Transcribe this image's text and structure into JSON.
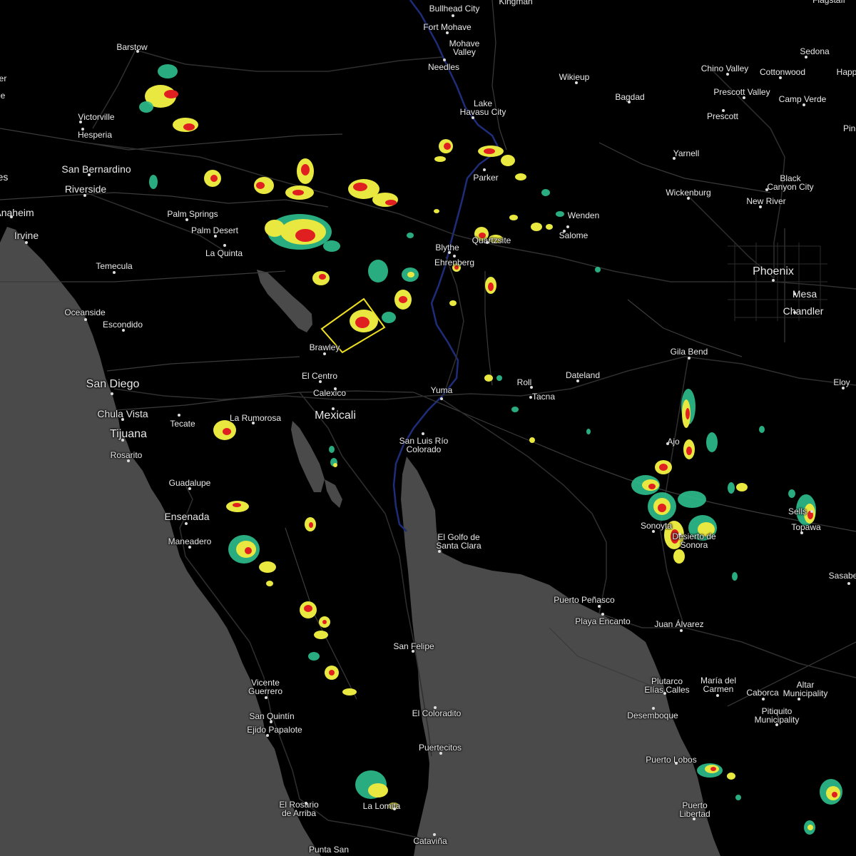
{
  "map": {
    "colors": {
      "water": "#4a4a4a",
      "land": "#000000",
      "roads": "#3a3a3a",
      "river": "#1c2a6b",
      "warning_box": "#f0e020",
      "radar_light": "#2dbf8e",
      "radar_mid": "#e8e840",
      "radar_heavy": "#e02020"
    },
    "places": [
      {
        "name": "Bullhead City"
      },
      {
        "name": "Kingman"
      },
      {
        "name": "Flagstaff"
      },
      {
        "name": "Fort Mohave"
      },
      {
        "name": "Mohave\nValley"
      },
      {
        "name": "Needles"
      },
      {
        "name": "Barstow"
      },
      {
        "name": "Sedona"
      },
      {
        "name": "Chino Valley"
      },
      {
        "name": "Cottonwood"
      },
      {
        "name": "Wikieup"
      },
      {
        "name": "Bagdad"
      },
      {
        "name": "Prescott Valley"
      },
      {
        "name": "Camp Verde"
      },
      {
        "name": "Prescott"
      },
      {
        "name": "Lake\nHavasu City"
      },
      {
        "name": "Victorville"
      },
      {
        "name": "Hesperia"
      },
      {
        "name": "Yarnell"
      },
      {
        "name": "San Bernardino"
      },
      {
        "name": "Riverside"
      },
      {
        "name": "Parker"
      },
      {
        "name": "Black\nCanyon City"
      },
      {
        "name": "Wickenburg"
      },
      {
        "name": "New River"
      },
      {
        "name": "Anaheim"
      },
      {
        "name": "Palm Springs"
      },
      {
        "name": "Wenden"
      },
      {
        "name": "Irvine"
      },
      {
        "name": "Palm Desert"
      },
      {
        "name": "Salome"
      },
      {
        "name": "Quartzsite"
      },
      {
        "name": "La Quinta"
      },
      {
        "name": "Blythe"
      },
      {
        "name": "Ehrenberg"
      },
      {
        "name": "Temecula"
      },
      {
        "name": "Phoenix"
      },
      {
        "name": "Mesa"
      },
      {
        "name": "Chandler"
      },
      {
        "name": "Oceanside"
      },
      {
        "name": "Escondido"
      },
      {
        "name": "Brawley"
      },
      {
        "name": "Gila Bend"
      },
      {
        "name": "El Centro"
      },
      {
        "name": "Roll"
      },
      {
        "name": "Dateland"
      },
      {
        "name": "Eloy"
      },
      {
        "name": "San Diego"
      },
      {
        "name": "Calexico"
      },
      {
        "name": "Yuma"
      },
      {
        "name": "Tacna"
      },
      {
        "name": "Chula Vista"
      },
      {
        "name": "La Rumorosa"
      },
      {
        "name": "Mexicali"
      },
      {
        "name": "Tecate"
      },
      {
        "name": "Tijuana"
      },
      {
        "name": "San Luis Río\nColorado"
      },
      {
        "name": "Rosarito"
      },
      {
        "name": "Ajo"
      },
      {
        "name": "Guadalupe"
      },
      {
        "name": "Ensenada"
      },
      {
        "name": "Sells"
      },
      {
        "name": "Topawa"
      },
      {
        "name": "Sonoyta"
      },
      {
        "name": "Desierto de\nSonora"
      },
      {
        "name": "Maneadero"
      },
      {
        "name": "El Golfo de\nSanta Clara"
      },
      {
        "name": "Sasabe"
      },
      {
        "name": "Puerto Peñasco"
      },
      {
        "name": "Playa Encanto"
      },
      {
        "name": "Juan Álvarez"
      },
      {
        "name": "San Felipe"
      },
      {
        "name": "Vicente\nGuerrero"
      },
      {
        "name": "Plutarco\nElías Calles"
      },
      {
        "name": "María del\nCarmen"
      },
      {
        "name": "Caborca"
      },
      {
        "name": "Altar\nMunicipality"
      },
      {
        "name": "San Quintín"
      },
      {
        "name": "El Coloradito"
      },
      {
        "name": "Desemboque"
      },
      {
        "name": "Pitiquito\nMunicipality"
      },
      {
        "name": "Ejido Papalote"
      },
      {
        "name": "Puertecitos"
      },
      {
        "name": "Puerto Lobos"
      },
      {
        "name": "El Rosario\nde Arriba"
      },
      {
        "name": "La Lomita"
      },
      {
        "name": "Puerto\nLibertad"
      },
      {
        "name": "Cataviña"
      },
      {
        "name": "Punta San"
      },
      {
        "name": "Happy"
      },
      {
        "name": "Pine"
      },
      {
        "name": "es"
      },
      {
        "name": "er"
      },
      {
        "name": "e"
      }
    ]
  }
}
